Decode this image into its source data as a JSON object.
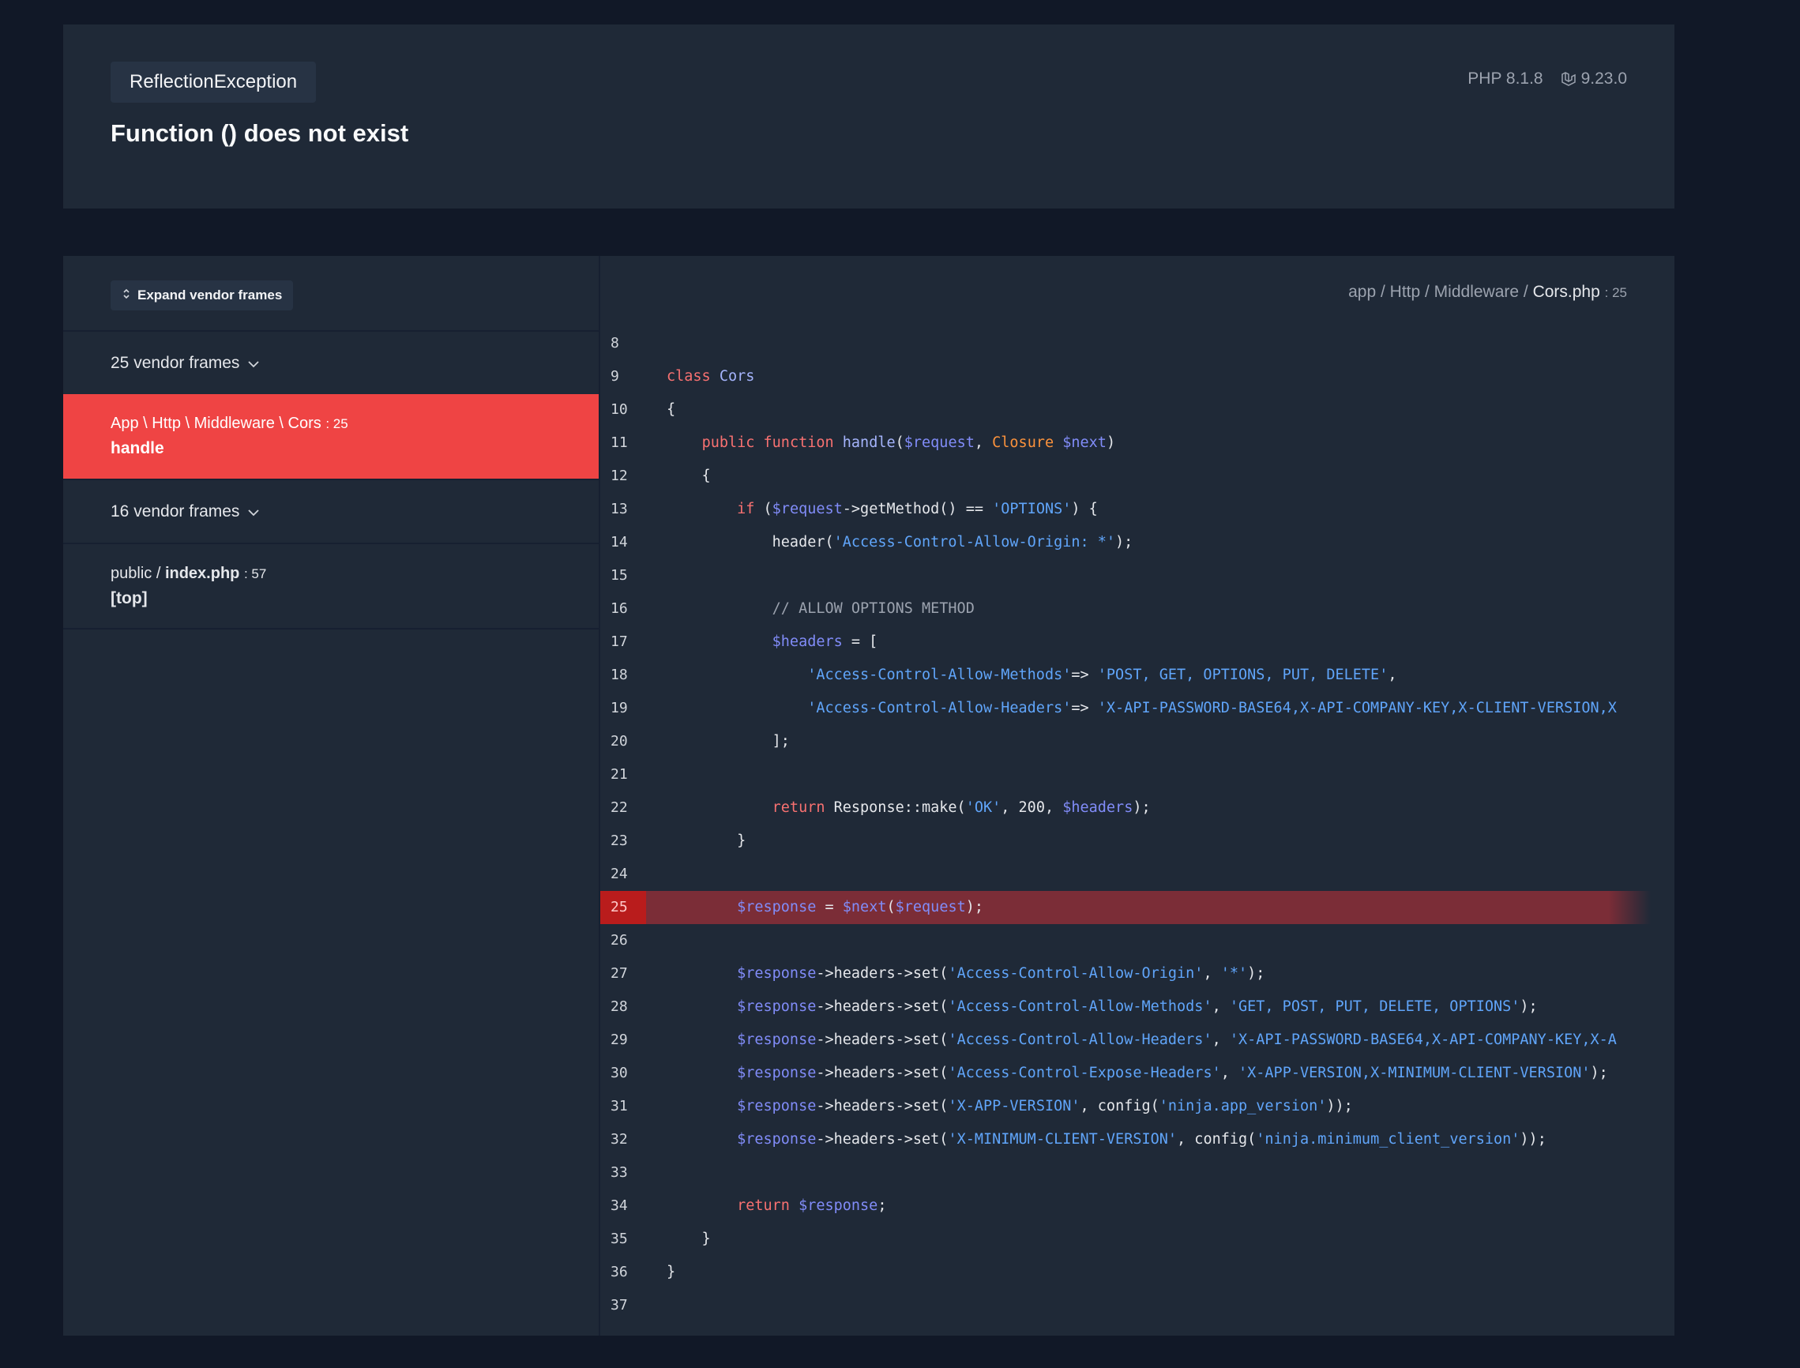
{
  "header": {
    "exception_class": "ReflectionException",
    "message": "Function () does not exist",
    "php_version": "PHP 8.1.8",
    "laravel_version": "9.23.0"
  },
  "sidebar": {
    "expand_label": "Expand vendor frames",
    "frames": [
      {
        "type": "vendor",
        "label": "25 vendor frames"
      },
      {
        "type": "app",
        "path": "App \\ Http \\ Middleware \\ Cors",
        "line": ": 25",
        "method": "handle",
        "selected": true
      },
      {
        "type": "vendor",
        "label": "16 vendor frames"
      },
      {
        "type": "app",
        "path_prefix": "public / ",
        "path_file": "index.php",
        "line": ": 57",
        "method": "[top]"
      }
    ]
  },
  "code": {
    "file_dir": "app / Http / Middleware / ",
    "file_name": "Cors.php",
    "file_line": ": 25",
    "highlighted_line": 25,
    "lines": [
      {
        "n": "8",
        "t": ""
      },
      {
        "n": "9",
        "t": "class Cors"
      },
      {
        "n": "10",
        "t": "{"
      },
      {
        "n": "11",
        "t": "    public function handle($request, Closure $next)"
      },
      {
        "n": "12",
        "t": "    {"
      },
      {
        "n": "13",
        "t": "        if ($request->getMethod() == 'OPTIONS') {"
      },
      {
        "n": "14",
        "t": "            header('Access-Control-Allow-Origin: *');"
      },
      {
        "n": "15",
        "t": ""
      },
      {
        "n": "16",
        "t": "            // ALLOW OPTIONS METHOD"
      },
      {
        "n": "17",
        "t": "            $headers = ["
      },
      {
        "n": "18",
        "t": "                'Access-Control-Allow-Methods'=> 'POST, GET, OPTIONS, PUT, DELETE',"
      },
      {
        "n": "19",
        "t": "                'Access-Control-Allow-Headers'=> 'X-API-PASSWORD-BASE64,X-API-COMPANY-KEY,X-CLIENT-VERSION,X"
      },
      {
        "n": "20",
        "t": "            ];"
      },
      {
        "n": "21",
        "t": ""
      },
      {
        "n": "22",
        "t": "            return Response::make('OK', 200, $headers);"
      },
      {
        "n": "23",
        "t": "        }"
      },
      {
        "n": "24",
        "t": ""
      },
      {
        "n": "25",
        "t": "        $response = $next($request);"
      },
      {
        "n": "26",
        "t": ""
      },
      {
        "n": "27",
        "t": "        $response->headers->set('Access-Control-Allow-Origin', '*');"
      },
      {
        "n": "28",
        "t": "        $response->headers->set('Access-Control-Allow-Methods', 'GET, POST, PUT, DELETE, OPTIONS');"
      },
      {
        "n": "29",
        "t": "        $response->headers->set('Access-Control-Allow-Headers', 'X-API-PASSWORD-BASE64,X-API-COMPANY-KEY,X-A"
      },
      {
        "n": "30",
        "t": "        $response->headers->set('Access-Control-Expose-Headers', 'X-APP-VERSION,X-MINIMUM-CLIENT-VERSION');"
      },
      {
        "n": "31",
        "t": "        $response->headers->set('X-APP-VERSION', config('ninja.app_version'));"
      },
      {
        "n": "32",
        "t": "        $response->headers->set('X-MINIMUM-CLIENT-VERSION', config('ninja.minimum_client_version'));"
      },
      {
        "n": "33",
        "t": ""
      },
      {
        "n": "34",
        "t": "        return $response;"
      },
      {
        "n": "35",
        "t": "    }"
      },
      {
        "n": "36",
        "t": "}"
      },
      {
        "n": "37",
        "t": ""
      }
    ]
  },
  "colors": {
    "page_bg": "#111827",
    "card_bg": "#1f2937",
    "selected_frame": "#ef4444",
    "highlight_line": "#7b2d37"
  }
}
